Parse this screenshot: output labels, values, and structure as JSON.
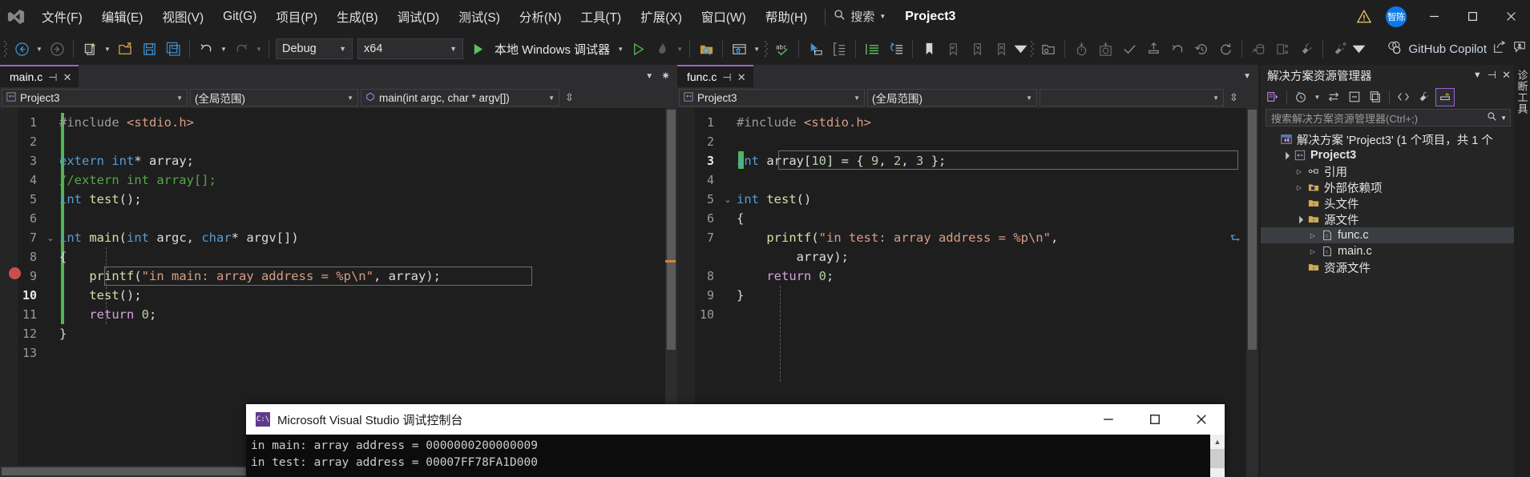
{
  "menubar": {
    "logo": "visual-studio-logo",
    "items": [
      "文件(F)",
      "编辑(E)",
      "视图(V)",
      "Git(G)",
      "项目(P)",
      "生成(B)",
      "调试(D)",
      "测试(S)",
      "分析(N)",
      "工具(T)",
      "扩展(X)",
      "窗口(W)",
      "帮助(H)"
    ],
    "search_label": "搜索",
    "project_title": "Project3",
    "avatar_text": "智陈",
    "window_buttons": [
      "minimize",
      "maximize",
      "close"
    ]
  },
  "toolbar": {
    "config": "Debug",
    "platform": "x64",
    "run_label": "本地 Windows 调试器",
    "copilot_label": "GitHub Copilot"
  },
  "editor_left": {
    "tab": "main.c",
    "nav_project": "Project3",
    "nav_scope": "(全局范围)",
    "nav_member": "main(int argc, char * argv[])",
    "breakpoint_line": 10,
    "current_line": 10,
    "lines": [
      {
        "n": 1,
        "fold": "",
        "indent": 0,
        "tokens": [
          {
            "t": "#include ",
            "c": "pp"
          },
          {
            "t": "<stdio.h>",
            "c": "str"
          }
        ]
      },
      {
        "n": 2,
        "fold": "",
        "indent": 0,
        "tokens": []
      },
      {
        "n": 3,
        "fold": "",
        "indent": 0,
        "tokens": [
          {
            "t": "extern",
            "c": "k"
          },
          {
            "t": " ",
            "c": "ws"
          },
          {
            "t": "int",
            "c": "k"
          },
          {
            "t": "* array;",
            "c": "ws"
          }
        ]
      },
      {
        "n": 4,
        "fold": "",
        "indent": 0,
        "tokens": [
          {
            "t": "//extern int array[];",
            "c": "cmt"
          }
        ]
      },
      {
        "n": 5,
        "fold": "",
        "indent": 0,
        "tokens": [
          {
            "t": "int",
            "c": "k"
          },
          {
            "t": " ",
            "c": "ws"
          },
          {
            "t": "test",
            "c": "fn"
          },
          {
            "t": "();",
            "c": "ws"
          }
        ]
      },
      {
        "n": 6,
        "fold": "",
        "indent": 0,
        "tokens": []
      },
      {
        "n": 7,
        "fold": "v",
        "indent": 0,
        "tokens": [
          {
            "t": "int",
            "c": "k"
          },
          {
            "t": " ",
            "c": "ws"
          },
          {
            "t": "main",
            "c": "fn"
          },
          {
            "t": "(",
            "c": "ws"
          },
          {
            "t": "int",
            "c": "k"
          },
          {
            "t": " argc, ",
            "c": "ws"
          },
          {
            "t": "char",
            "c": "k"
          },
          {
            "t": "* argv[])",
            "c": "ws"
          }
        ]
      },
      {
        "n": 8,
        "fold": "",
        "indent": 1,
        "tokens": [
          {
            "t": "{",
            "c": "ws"
          }
        ]
      },
      {
        "n": 9,
        "fold": "",
        "indent": 1,
        "tokens": [
          {
            "t": "    ",
            "c": "ws"
          },
          {
            "t": "printf",
            "c": "fn"
          },
          {
            "t": "(",
            "c": "ws"
          },
          {
            "t": "\"in main: array address = %p\\n\"",
            "c": "str"
          },
          {
            "t": ", array);",
            "c": "ws"
          }
        ]
      },
      {
        "n": 10,
        "fold": "",
        "indent": 1,
        "tokens": [
          {
            "t": "    ",
            "c": "ws"
          },
          {
            "t": "test",
            "c": "fn"
          },
          {
            "t": "();",
            "c": "ws"
          }
        ]
      },
      {
        "n": 11,
        "fold": "",
        "indent": 1,
        "tokens": [
          {
            "t": "    ",
            "c": "ws"
          },
          {
            "t": "return",
            "c": "kw2"
          },
          {
            "t": " ",
            "c": "ws"
          },
          {
            "t": "0",
            "c": "num"
          },
          {
            "t": ";",
            "c": "ws"
          }
        ]
      },
      {
        "n": 12,
        "fold": "",
        "indent": 1,
        "tokens": [
          {
            "t": "}",
            "c": "ws"
          }
        ]
      },
      {
        "n": 13,
        "fold": "",
        "indent": 0,
        "tokens": []
      }
    ]
  },
  "editor_right": {
    "tab": "func.c",
    "nav_project": "Project3",
    "nav_scope": "(全局范围)",
    "nav_member": "",
    "current_line": 3,
    "lines": [
      {
        "n": 1,
        "fold": "",
        "indent": 0,
        "tokens": [
          {
            "t": "#include ",
            "c": "pp"
          },
          {
            "t": "<stdio.h>",
            "c": "str"
          }
        ]
      },
      {
        "n": 2,
        "fold": "",
        "indent": 0,
        "tokens": []
      },
      {
        "n": 3,
        "fold": "",
        "indent": 0,
        "tokens": [
          {
            "t": "int",
            "c": "k"
          },
          {
            "t": " array[",
            "c": "ws"
          },
          {
            "t": "10",
            "c": "num"
          },
          {
            "t": "] = { ",
            "c": "ws"
          },
          {
            "t": "9",
            "c": "num"
          },
          {
            "t": ", ",
            "c": "ws"
          },
          {
            "t": "2",
            "c": "num"
          },
          {
            "t": ", ",
            "c": "ws"
          },
          {
            "t": "3",
            "c": "num"
          },
          {
            "t": " };",
            "c": "ws"
          }
        ]
      },
      {
        "n": 4,
        "fold": "",
        "indent": 0,
        "tokens": []
      },
      {
        "n": 5,
        "fold": "v",
        "indent": 0,
        "tokens": [
          {
            "t": "int",
            "c": "k"
          },
          {
            "t": " ",
            "c": "ws"
          },
          {
            "t": "test",
            "c": "fn"
          },
          {
            "t": "()",
            "c": "ws"
          }
        ]
      },
      {
        "n": 6,
        "fold": "",
        "indent": 1,
        "tokens": [
          {
            "t": "{",
            "c": "ws"
          }
        ]
      },
      {
        "n": 7,
        "fold": "",
        "indent": 1,
        "tokens": [
          {
            "t": "    ",
            "c": "ws"
          },
          {
            "t": "printf",
            "c": "fn"
          },
          {
            "t": "(",
            "c": "ws"
          },
          {
            "t": "\"in test: array address = %p\\n\"",
            "c": "str"
          },
          {
            "t": ",",
            "c": "ws"
          }
        ]
      },
      {
        "n": "",
        "fold": "",
        "indent": 1,
        "tokens": [
          {
            "t": "        array);",
            "c": "ws"
          }
        ]
      },
      {
        "n": 8,
        "fold": "",
        "indent": 1,
        "tokens": [
          {
            "t": "    ",
            "c": "ws"
          },
          {
            "t": "return",
            "c": "kw2"
          },
          {
            "t": " ",
            "c": "ws"
          },
          {
            "t": "0",
            "c": "num"
          },
          {
            "t": ";",
            "c": "ws"
          }
        ]
      },
      {
        "n": 9,
        "fold": "",
        "indent": 1,
        "tokens": [
          {
            "t": "}",
            "c": "ws"
          }
        ]
      },
      {
        "n": 10,
        "fold": "",
        "indent": 0,
        "tokens": []
      }
    ]
  },
  "solution_explorer": {
    "title": "解决方案资源管理器",
    "search_placeholder": "搜索解决方案资源管理器(Ctrl+;)",
    "tree": [
      {
        "label": "解决方案 'Project3' (1 个项目，共 1 个",
        "icon": "solution-icon",
        "arrow": "",
        "depth": 0,
        "bold": false,
        "sel": false
      },
      {
        "label": "Project3",
        "icon": "cpp-project-icon",
        "arrow": "down",
        "depth": 1,
        "bold": true,
        "sel": false
      },
      {
        "label": "引用",
        "icon": "references-icon",
        "arrow": "right",
        "depth": 2,
        "bold": false,
        "sel": false
      },
      {
        "label": "外部依赖项",
        "icon": "ext-deps-icon",
        "arrow": "right",
        "depth": 2,
        "bold": false,
        "sel": false
      },
      {
        "label": "头文件",
        "icon": "filter-folder-icon",
        "arrow": "",
        "depth": 2,
        "bold": false,
        "sel": false
      },
      {
        "label": "源文件",
        "icon": "filter-folder-icon",
        "arrow": "down",
        "depth": 2,
        "bold": false,
        "sel": false
      },
      {
        "label": "func.c",
        "icon": "c-file-icon",
        "arrow": "right",
        "depth": 3,
        "bold": false,
        "sel": true
      },
      {
        "label": "main.c",
        "icon": "c-file-icon",
        "arrow": "right",
        "depth": 3,
        "bold": false,
        "sel": false
      },
      {
        "label": "资源文件",
        "icon": "filter-folder-icon",
        "arrow": "",
        "depth": 2,
        "bold": false,
        "sel": false
      }
    ],
    "diagnostics_tab": "诊断工具"
  },
  "console": {
    "title": "Microsoft Visual Studio 调试控制台",
    "lines": [
      "in main: array address = 0000000200000009",
      "in test: array address = 00007FF78FA1D000"
    ],
    "window_buttons": [
      "minimize",
      "maximize",
      "close"
    ]
  },
  "colors": {
    "accent_purple": "#9c62d6",
    "chrome_bg": "#1f1f1f",
    "editor_bg": "#1e1e1e",
    "panel_bg": "#252526",
    "breakpoint_red": "#c94f4f",
    "change_green": "#4fb84f"
  }
}
